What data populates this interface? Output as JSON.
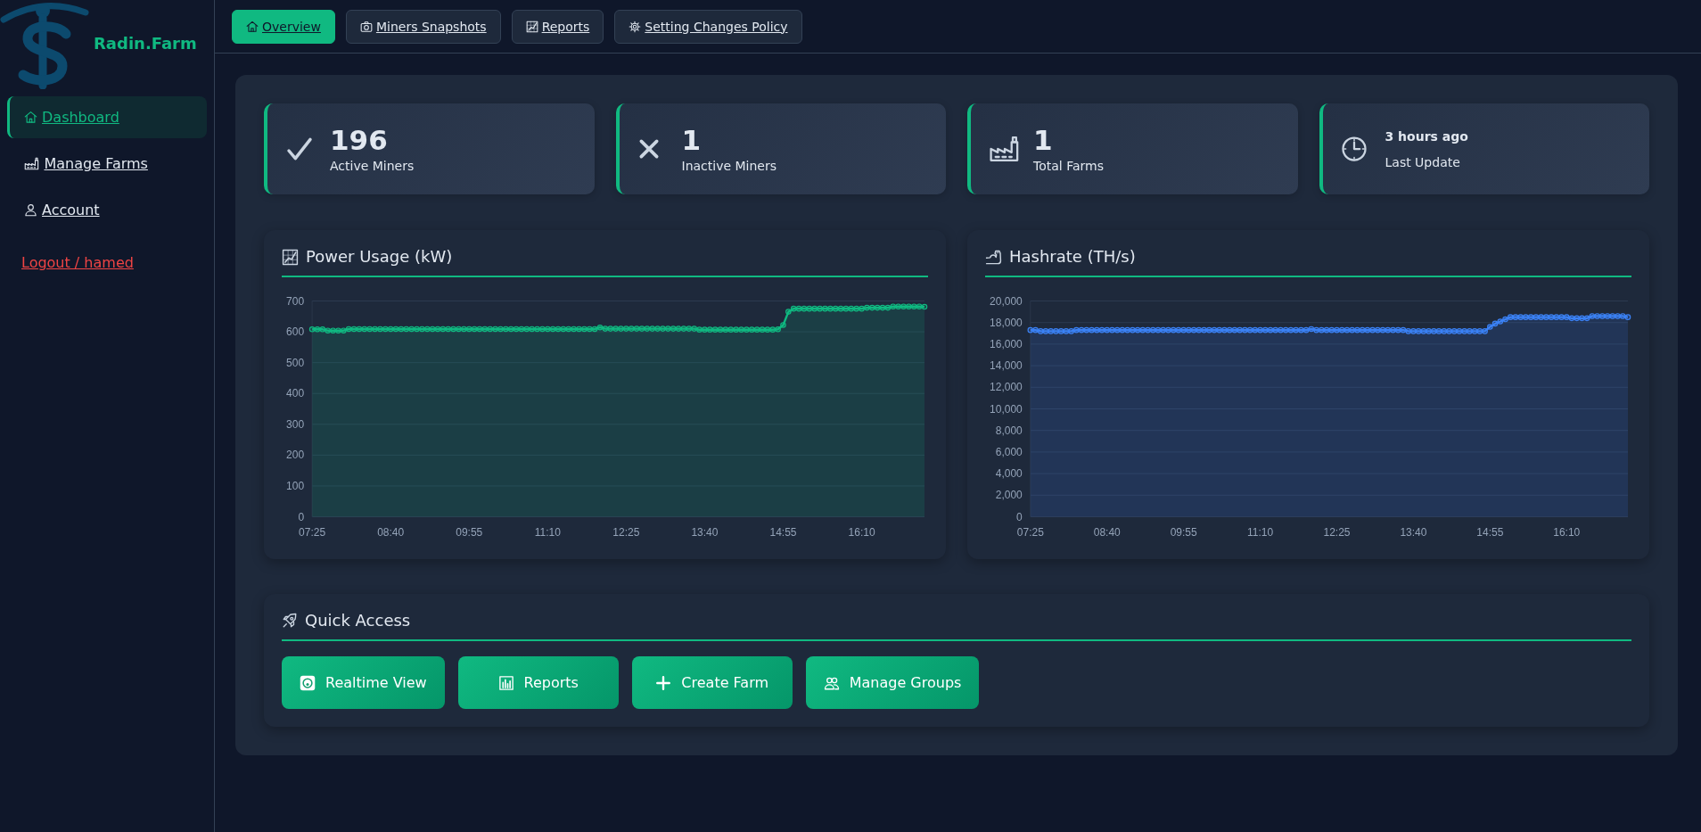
{
  "sidebar": {
    "brand": "Radin.Farm",
    "items": [
      {
        "label": "Dashboard",
        "selected": true
      },
      {
        "label": "Manage Farms",
        "selected": false
      },
      {
        "label": "Account",
        "selected": false
      }
    ],
    "logout": "Logout / hamed"
  },
  "top_nav": [
    {
      "label": "Overview",
      "selected": true
    },
    {
      "label": "Miners Snapshots",
      "selected": false
    },
    {
      "label": "Reports",
      "selected": false
    },
    {
      "label": "Setting Changes Policy",
      "selected": false
    }
  ],
  "stats": [
    {
      "kind": "count",
      "value": "196",
      "label": "Active Miners"
    },
    {
      "kind": "count",
      "value": "1",
      "label": "Inactive Miners"
    },
    {
      "kind": "count",
      "value": "1",
      "label": "Total Farms"
    },
    {
      "kind": "time",
      "value": "3 hours ago",
      "label": "Last Update"
    }
  ],
  "charts": [
    {
      "chart_data": {
        "type": "area",
        "title": "Power Usage (kW)",
        "grid": true,
        "x": [
          445,
          450,
          455,
          460,
          465,
          470,
          475,
          480,
          485,
          490,
          495,
          500,
          505,
          510,
          515,
          520,
          525,
          530,
          535,
          540,
          545,
          550,
          555,
          560,
          565,
          570,
          575,
          580,
          585,
          590,
          595,
          600,
          605,
          610,
          615,
          620,
          625,
          630,
          635,
          640,
          645,
          650,
          655,
          660,
          665,
          670,
          675,
          680,
          685,
          690,
          695,
          700,
          705,
          710,
          715,
          720,
          725,
          730,
          735,
          740,
          745,
          750,
          755,
          760,
          765,
          770,
          775,
          780,
          785,
          790,
          795,
          800,
          805,
          810,
          815,
          820,
          825,
          830,
          835,
          840,
          845,
          850,
          855,
          860,
          865,
          870,
          875,
          880,
          885,
          890,
          895,
          900,
          905,
          910,
          915,
          920,
          925,
          930,
          935,
          940,
          945,
          950,
          955,
          960,
          965,
          970,
          975,
          980,
          985,
          990,
          995,
          1000,
          1005,
          1010,
          1015,
          1020,
          1025,
          1030
        ],
        "series": [
          {
            "color": "#10b981",
            "values": [
              608,
              608,
              608,
              604,
              604,
              604,
              604,
              609,
              609,
              609,
              609,
              609,
              609,
              609,
              609,
              609,
              609,
              609,
              609,
              609,
              609,
              609,
              609,
              609,
              609,
              609,
              609,
              609,
              609,
              609,
              609,
              609,
              609,
              609,
              609,
              609,
              609,
              609,
              609,
              609,
              609,
              609,
              609,
              609,
              609,
              609,
              609,
              609,
              609,
              609,
              609,
              609,
              609,
              609,
              609,
              614,
              610,
              610,
              610,
              610,
              610,
              610,
              610,
              610,
              610,
              610,
              610,
              610,
              610,
              610,
              610,
              610,
              610,
              610,
              607,
              607,
              607,
              607,
              607,
              607,
              607,
              607,
              607,
              607,
              607,
              607,
              607,
              607,
              607,
              608,
              622,
              665,
              675,
              675,
              675,
              675,
              675,
              675,
              675,
              675,
              675,
              675,
              675,
              675,
              675,
              675,
              678,
              678,
              678,
              678,
              678,
              682,
              682,
              682,
              682,
              682,
              682,
              681
            ]
          }
        ],
        "xlim": [
          445,
          1030
        ],
        "ylim": [
          0,
          700
        ],
        "xticks": [
          {
            "value": 445,
            "label": "07:25"
          },
          {
            "value": 520,
            "label": "08:40"
          },
          {
            "value": 595,
            "label": "09:55"
          },
          {
            "value": 670,
            "label": "11:10"
          },
          {
            "value": 745,
            "label": "12:25"
          },
          {
            "value": 820,
            "label": "13:40"
          },
          {
            "value": 895,
            "label": "14:55"
          },
          {
            "value": 970,
            "label": "16:10"
          }
        ],
        "yticks": [
          0,
          100,
          200,
          300,
          400,
          500,
          600,
          700
        ]
      }
    },
    {
      "chart_data": {
        "type": "area",
        "title": "Hashrate (TH/s)",
        "grid": true,
        "x": [
          445,
          450,
          455,
          460,
          465,
          470,
          475,
          480,
          485,
          490,
          495,
          500,
          505,
          510,
          515,
          520,
          525,
          530,
          535,
          540,
          545,
          550,
          555,
          560,
          565,
          570,
          575,
          580,
          585,
          590,
          595,
          600,
          605,
          610,
          615,
          620,
          625,
          630,
          635,
          640,
          645,
          650,
          655,
          660,
          665,
          670,
          675,
          680,
          685,
          690,
          695,
          700,
          705,
          710,
          715,
          720,
          725,
          730,
          735,
          740,
          745,
          750,
          755,
          760,
          765,
          770,
          775,
          780,
          785,
          790,
          795,
          800,
          805,
          810,
          815,
          820,
          825,
          830,
          835,
          840,
          845,
          850,
          855,
          860,
          865,
          870,
          875,
          880,
          885,
          890,
          895,
          900,
          905,
          910,
          915,
          920,
          925,
          930,
          935,
          940,
          945,
          950,
          955,
          960,
          965,
          970,
          975,
          980,
          985,
          990,
          995,
          1000,
          1005,
          1010,
          1015,
          1020,
          1025,
          1030
        ],
        "series": [
          {
            "color": "#3b82f6",
            "values": [
              17300,
              17300,
              17200,
              17200,
              17200,
              17200,
              17200,
              17200,
              17200,
              17300,
              17300,
              17300,
              17300,
              17300,
              17300,
              17300,
              17300,
              17300,
              17300,
              17300,
              17300,
              17300,
              17300,
              17300,
              17300,
              17300,
              17300,
              17300,
              17300,
              17300,
              17300,
              17300,
              17300,
              17300,
              17300,
              17300,
              17300,
              17300,
              17300,
              17300,
              17300,
              17300,
              17300,
              17300,
              17300,
              17300,
              17300,
              17300,
              17300,
              17300,
              17300,
              17300,
              17300,
              17300,
              17300,
              17400,
              17300,
              17300,
              17300,
              17300,
              17300,
              17300,
              17300,
              17300,
              17300,
              17300,
              17300,
              17300,
              17300,
              17300,
              17300,
              17300,
              17300,
              17300,
              17200,
              17200,
              17200,
              17200,
              17200,
              17200,
              17200,
              17200,
              17200,
              17200,
              17200,
              17200,
              17200,
              17200,
              17200,
              17200,
              17600,
              17900,
              18100,
              18300,
              18500,
              18500,
              18500,
              18500,
              18500,
              18500,
              18500,
              18500,
              18500,
              18500,
              18500,
              18500,
              18400,
              18400,
              18400,
              18400,
              18600,
              18600,
              18600,
              18600,
              18600,
              18600,
              18600,
              18500
            ]
          }
        ],
        "xlim": [
          445,
          1030
        ],
        "ylim": [
          0,
          20000
        ],
        "xticks": [
          {
            "value": 445,
            "label": "07:25"
          },
          {
            "value": 520,
            "label": "08:40"
          },
          {
            "value": 595,
            "label": "09:55"
          },
          {
            "value": 670,
            "label": "11:10"
          },
          {
            "value": 745,
            "label": "12:25"
          },
          {
            "value": 820,
            "label": "13:40"
          },
          {
            "value": 895,
            "label": "14:55"
          },
          {
            "value": 970,
            "label": "16:10"
          }
        ],
        "yticks": [
          0,
          {
            "value": 2000,
            "label": "2,000"
          },
          {
            "value": 4000,
            "label": "4,000"
          },
          {
            "value": 6000,
            "label": "6,000"
          },
          {
            "value": 8000,
            "label": "8,000"
          },
          {
            "value": 10000,
            "label": "10,000"
          },
          {
            "value": 12000,
            "label": "12,000"
          },
          {
            "value": 14000,
            "label": "14,000"
          },
          {
            "value": 16000,
            "label": "16,000"
          },
          {
            "value": 18000,
            "label": "18,000"
          },
          {
            "value": 20000,
            "label": "20,000"
          }
        ]
      }
    }
  ],
  "quick_access": {
    "title": "Quick Access",
    "buttons": [
      "Realtime View",
      "Reports",
      "Create Farm",
      "Manage Groups"
    ]
  }
}
